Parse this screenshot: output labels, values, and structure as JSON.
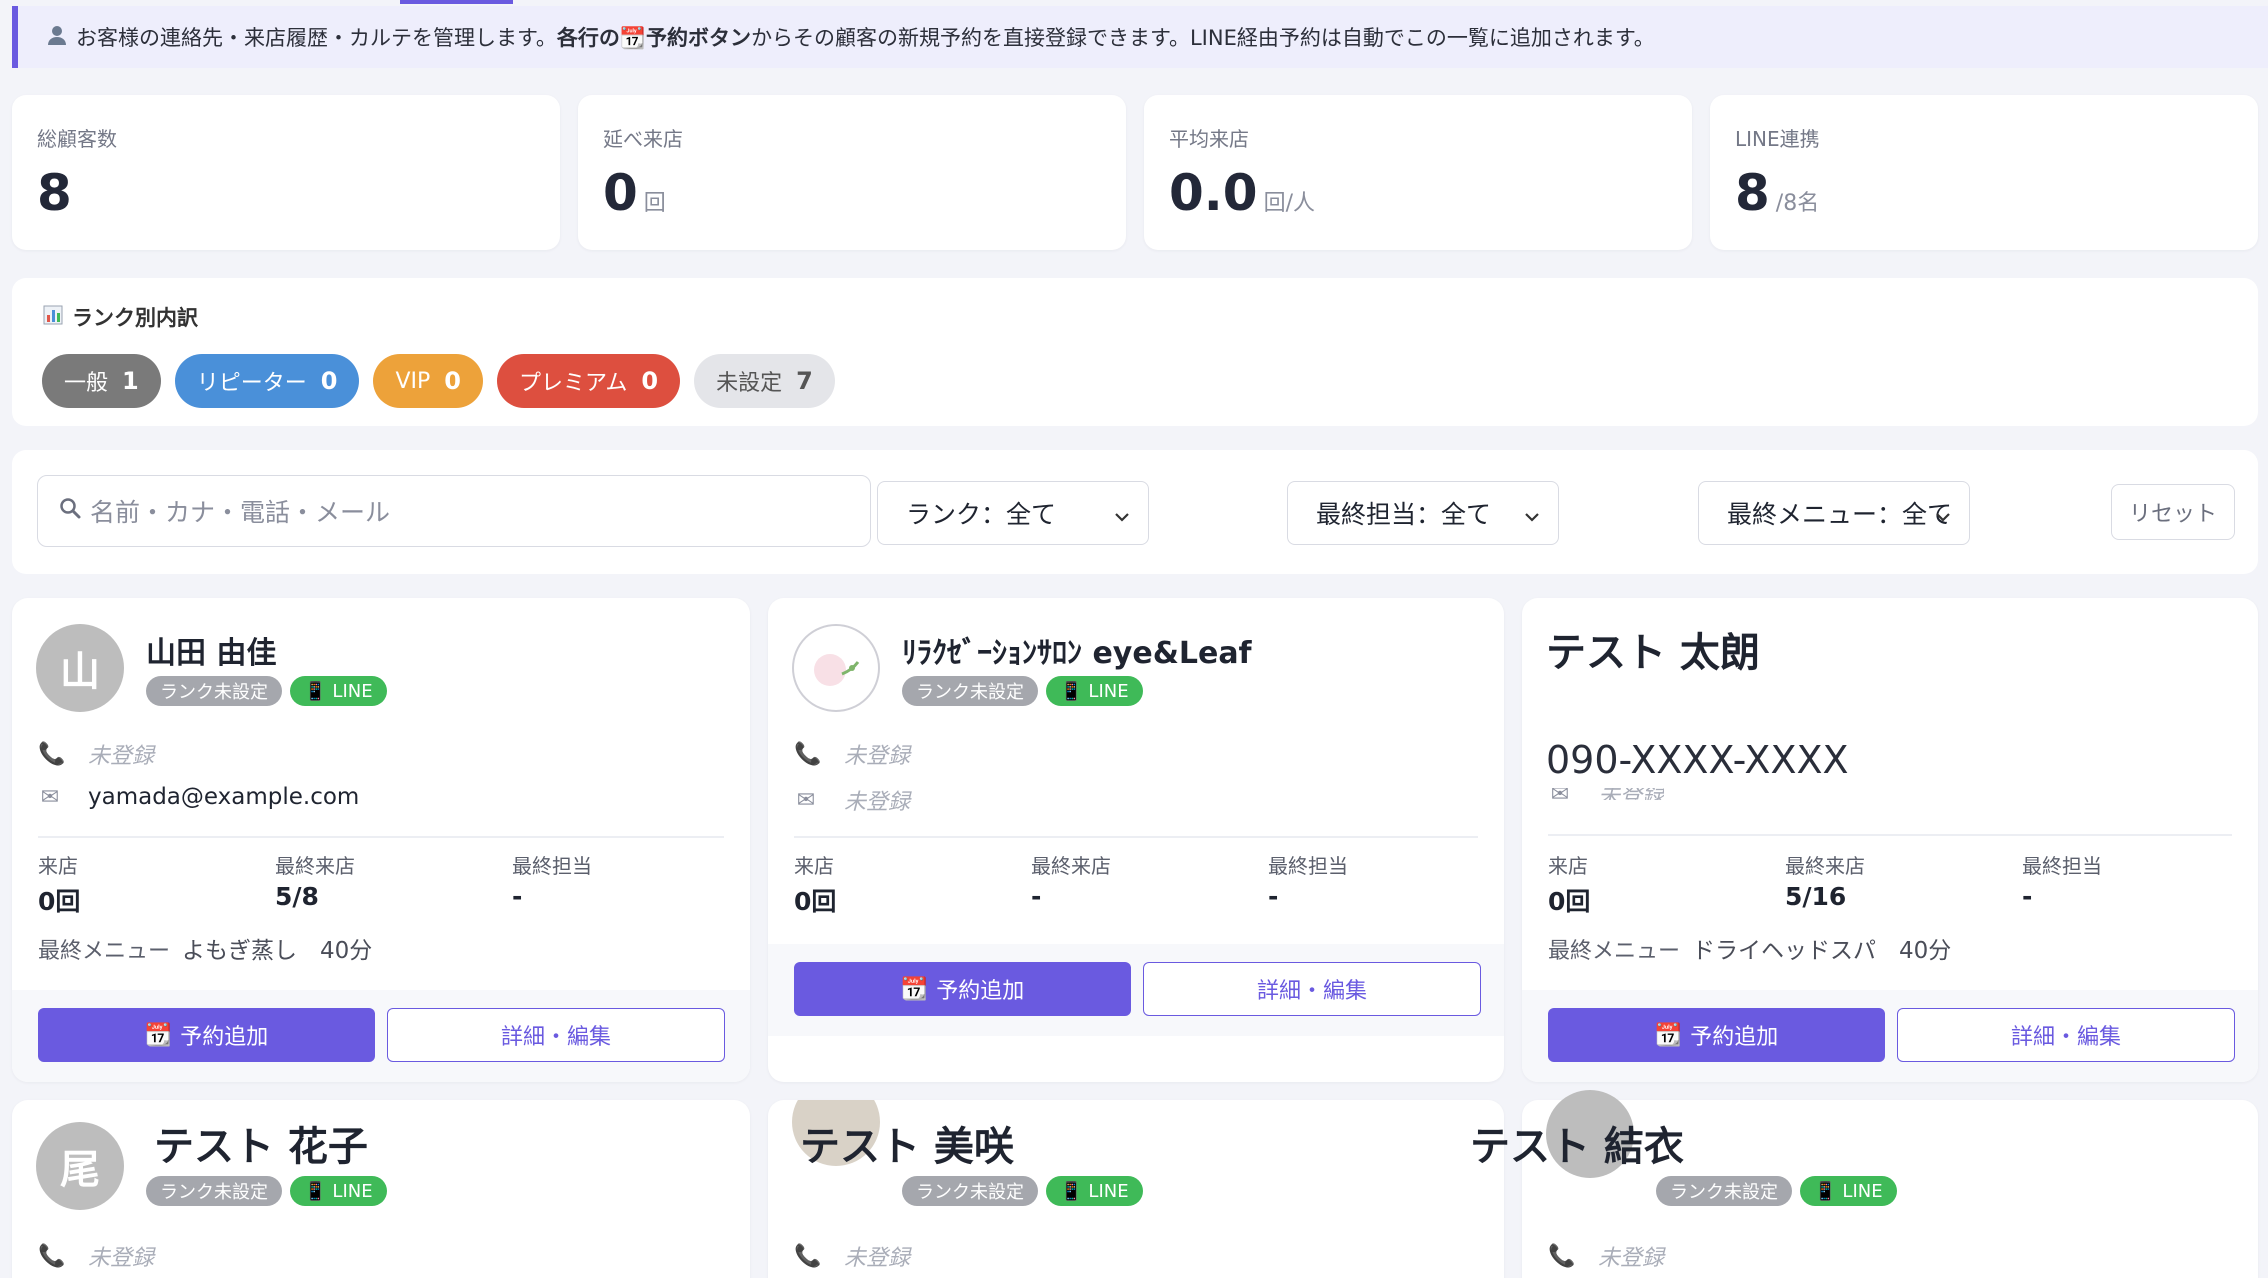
{
  "notice": {
    "icon": "person-icon",
    "text_part1": "お客様の連絡先・来店履歴・カルテを管理します。",
    "bold_part": "各行の📆予約ボタン",
    "text_part2": "からその顧客の新規予約を直接登録できます。LINE経由予約は自動でこの一覧に追加されます。"
  },
  "stats": [
    {
      "label": "総顧客数",
      "value": "8",
      "unit": ""
    },
    {
      "label": "延べ来店",
      "value": "0",
      "unit": "回"
    },
    {
      "label": "平均来店",
      "value": "0.0",
      "unit": "回/人"
    },
    {
      "label": "LINE連携",
      "value": "8",
      "unit": "/8名"
    }
  ],
  "rank_breakdown": {
    "title": "ランク別内訳",
    "pills": [
      {
        "label": "一般",
        "count": "1",
        "color": "#7a7a7a"
      },
      {
        "label": "リピーター",
        "count": "0",
        "color": "#4a90d9"
      },
      {
        "label": "VIP",
        "count": "0",
        "color": "#eda23a"
      },
      {
        "label": "プレミアム",
        "count": "0",
        "color": "#dd4f3f"
      },
      {
        "label": "未設定",
        "count": "7",
        "color": "#e4e5e9"
      }
    ]
  },
  "filters": {
    "search_placeholder": "名前・カナ・電話・メール",
    "rank": "ランク：全て",
    "staff": "最終担当：全て",
    "menu": "最終メニュー：全て",
    "reset": "リセット"
  },
  "labels": {
    "rank_unset": "ランク未設定",
    "line": "LINE",
    "not_registered": "未登録",
    "visits": "来店",
    "last_visit": "最終来店",
    "last_staff": "最終担当",
    "last_menu": "最終メニュー",
    "reserve": "予約追加",
    "edit": "詳細・編集"
  },
  "customers": [
    {
      "name": "山田 由佳",
      "avatar": "山",
      "phone": "未登録",
      "email": "yamada@example.com",
      "visits": "0回",
      "last_visit": "5/8",
      "last_staff": "-",
      "last_menu": "よもぎ蒸し　40分"
    },
    {
      "name": "ﾘﾗｸｾﾞｰｼｮﾝｻﾛﾝ eye&Leaf",
      "avatar": "",
      "phone": "未登録",
      "email": "未登録",
      "visits": "0回",
      "last_visit": "-",
      "last_staff": "-",
      "last_menu": ""
    },
    {
      "name": "テスト 太朗",
      "avatar": "",
      "phone": "090-XXXX-XXXX",
      "email": "未登録",
      "visits": "0回",
      "last_visit": "5/16",
      "last_staff": "-",
      "last_menu": "ドライヘッドスパ　40分"
    },
    {
      "name": "テスト 花子",
      "avatar": "尾",
      "phone": "未登録"
    },
    {
      "name": "テスト 美咲",
      "avatar": "",
      "phone": "未登録"
    },
    {
      "name": "テスト 結衣",
      "avatar": "",
      "phone": "未登録"
    }
  ]
}
